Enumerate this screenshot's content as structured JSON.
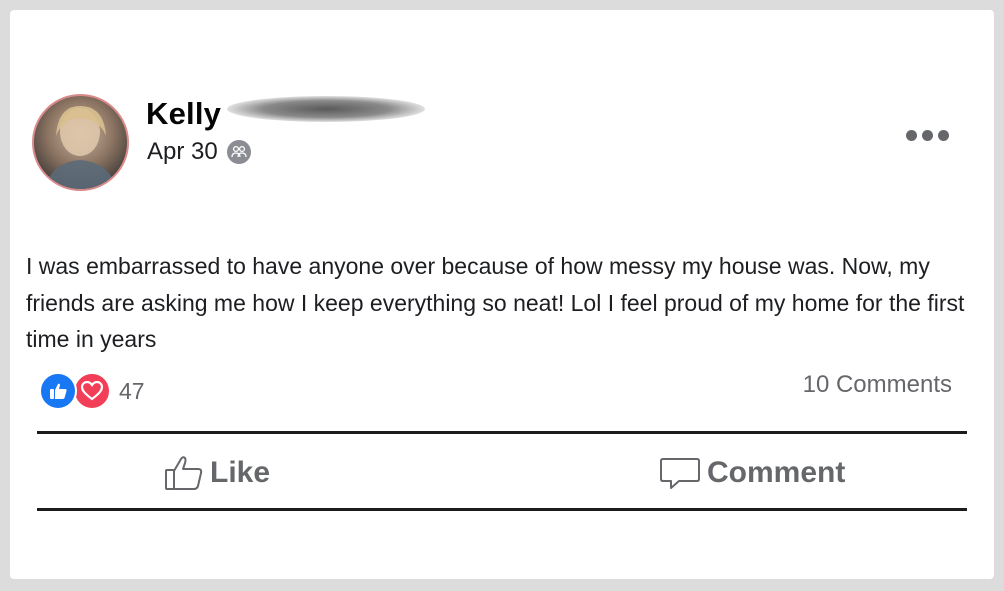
{
  "post": {
    "author_name": "Kelly",
    "date": "Apr 30",
    "audience_icon": "friends-icon",
    "body": "I was embarrassed to have anyone over because of how messy my house was. Now, my friends are asking me how I keep everything so neat! Lol I feel proud of my home for the first time in years"
  },
  "reactions": {
    "icons": [
      "like-icon",
      "love-icon"
    ],
    "count": "47",
    "comments_label": "10 Comments"
  },
  "actions": {
    "like_label": "Like",
    "comment_label": "Comment"
  },
  "colors": {
    "like_blue": "#1877f2",
    "love_red": "#f33e58",
    "secondary_text": "#65676b"
  }
}
